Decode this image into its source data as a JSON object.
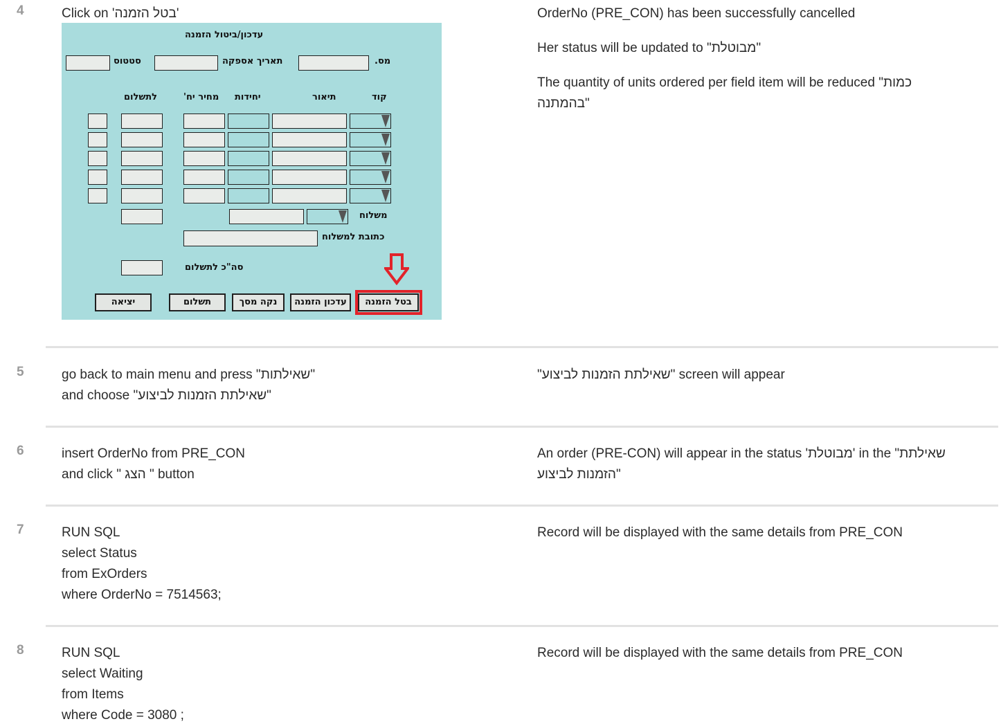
{
  "steps": [
    {
      "number": "4",
      "action": [
        "Click on 'בטל הזמנה'"
      ],
      "expected": [
        "OrderNo (PRE_CON) has been successfully cancelled",
        "Her status will be updated to \"מבוטלת\"",
        "The quantity of units ordered per field item will be reduced \"כמות בהמתנה\""
      ]
    },
    {
      "number": "5",
      "action": [
        "go back to main menu and press \"שאילתות\"",
        "and choose \"שאילתת הזמנות לביצוע\""
      ],
      "expected": [
        "\"שאילתת הזמנות לביצוע\" screen will appear"
      ]
    },
    {
      "number": "6",
      "action": [
        "insert OrderNo from PRE_CON",
        "and click \" הצג \" button"
      ],
      "expected": [
        "An order (PRE-CON) will appear in the status 'מבוטלת' in the \"שאילתת הזמנות לביצוע\""
      ]
    },
    {
      "number": "7",
      "action": [
        "RUN SQL",
        "select Status",
        "from ExOrders",
        "where OrderNo = 7514563;"
      ],
      "expected": [
        "Record will be displayed with the same details from PRE_CON"
      ]
    },
    {
      "number": "8",
      "action": [
        "RUN SQL",
        "select Waiting",
        "from Items",
        "where Code = 3080 ;"
      ],
      "expected": [
        "Record will be displayed with the same details from PRE_CON"
      ]
    }
  ],
  "form": {
    "title": "עדכון/ביטול הזמנה",
    "order_no_label": "מס.",
    "supply_date_label": "תאריך אספקה",
    "status_label": "סטטוס",
    "columns": {
      "code": "קוד",
      "description": "תיאור",
      "units": "יחידות",
      "unit_price": "מחיר יח'",
      "to_pay": "לתשלום"
    },
    "shipping_label": "משלוח",
    "shipping_address_label": "כתובת למשלוח",
    "total_label": "סה\"כ לתשלום",
    "buttons": {
      "cancel_order": "בטל הזמנה",
      "update_order": "עדכון הזמנה",
      "clear_screen": "נקה מסך",
      "payment": "תשלום",
      "exit": "יציאה"
    },
    "highlight_color": "#e2232a",
    "background_color": "#a9dcdd"
  }
}
